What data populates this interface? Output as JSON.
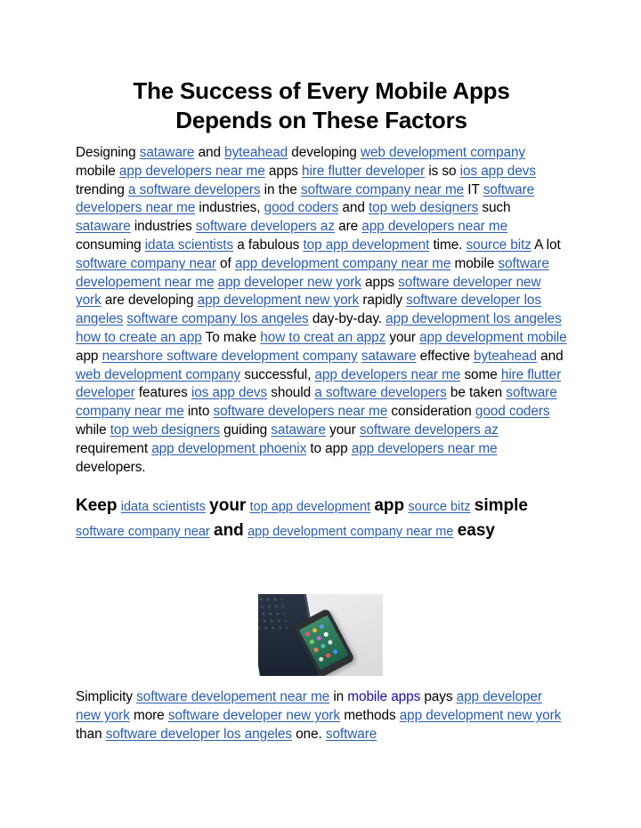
{
  "document": {
    "title_lines": [
      "The Success of Every Mobile Apps",
      "Depends on These Factors"
    ],
    "link_color": "#2a5db0",
    "plain_link_color": "#1a0dab",
    "paragraph_1": [
      {
        "t": "text",
        "v": "Designing "
      },
      {
        "t": "link",
        "v": "sataware"
      },
      {
        "t": "text",
        "v": " and "
      },
      {
        "t": "link",
        "v": "byteahead"
      },
      {
        "t": "text",
        "v": " developing "
      },
      {
        "t": "link",
        "v": "web development company"
      },
      {
        "t": "text",
        "v": " mobile "
      },
      {
        "t": "link",
        "v": "app developers near me"
      },
      {
        "t": "text",
        "v": " apps "
      },
      {
        "t": "link",
        "v": "hire flutter developer"
      },
      {
        "t": "text",
        "v": " is so "
      },
      {
        "t": "link",
        "v": "ios app devs"
      },
      {
        "t": "text",
        "v": " trending "
      },
      {
        "t": "link",
        "v": "a software developers"
      },
      {
        "t": "text",
        "v": " in the "
      },
      {
        "t": "link",
        "v": "software company near me"
      },
      {
        "t": "text",
        "v": " IT "
      },
      {
        "t": "link",
        "v": "software developers near me"
      },
      {
        "t": "text",
        "v": " industries, "
      },
      {
        "t": "link",
        "v": "good coders"
      },
      {
        "t": "text",
        "v": " and "
      },
      {
        "t": "link",
        "v": "top web designers"
      },
      {
        "t": "text",
        "v": " such "
      },
      {
        "t": "link",
        "v": "sataware"
      },
      {
        "t": "text",
        "v": " industries "
      },
      {
        "t": "link",
        "v": "software developers az"
      },
      {
        "t": "text",
        "v": " are "
      },
      {
        "t": "link",
        "v": "app developers near me"
      },
      {
        "t": "text",
        "v": " consuming "
      },
      {
        "t": "link",
        "v": "idata scientists"
      },
      {
        "t": "text",
        "v": " a fabulous "
      },
      {
        "t": "link",
        "v": "top app development"
      },
      {
        "t": "text",
        "v": " time. "
      },
      {
        "t": "link",
        "v": "source bitz"
      },
      {
        "t": "text",
        "v": " A lot "
      },
      {
        "t": "link",
        "v": "software company near"
      },
      {
        "t": "text",
        "v": " of "
      },
      {
        "t": "link",
        "v": "app development company near me"
      },
      {
        "t": "text",
        "v": " mobile "
      },
      {
        "t": "link",
        "v": "software developement near me"
      },
      {
        "t": "text",
        "v": " "
      },
      {
        "t": "link",
        "v": "app developer new york"
      },
      {
        "t": "text",
        "v": " apps "
      },
      {
        "t": "link",
        "v": "software developer new york"
      },
      {
        "t": "text",
        "v": " are developing "
      },
      {
        "t": "link",
        "v": "app development new york"
      },
      {
        "t": "text",
        "v": " rapidly "
      },
      {
        "t": "link",
        "v": "software developer los angeles"
      },
      {
        "t": "text",
        "v": " "
      },
      {
        "t": "link",
        "v": "software company los angeles"
      },
      {
        "t": "text",
        "v": " day-by-day. "
      },
      {
        "t": "link",
        "v": "app development los angeles"
      },
      {
        "t": "text",
        "v": " "
      },
      {
        "t": "link",
        "v": "how to create an app"
      },
      {
        "t": "text",
        "v": " To make "
      },
      {
        "t": "link",
        "v": "how to creat an appz"
      },
      {
        "t": "text",
        "v": " your "
      },
      {
        "t": "link",
        "v": "app development mobile"
      },
      {
        "t": "text",
        "v": " app "
      },
      {
        "t": "link",
        "v": "nearshore software development company"
      },
      {
        "t": "text",
        "v": " "
      },
      {
        "t": "link",
        "v": "sataware"
      },
      {
        "t": "text",
        "v": " effective "
      },
      {
        "t": "link",
        "v": "byteahead"
      },
      {
        "t": "text",
        "v": " and "
      },
      {
        "t": "link",
        "v": "web development company"
      },
      {
        "t": "text",
        "v": " successful, "
      },
      {
        "t": "link",
        "v": "app developers near me"
      },
      {
        "t": "text",
        "v": " some "
      },
      {
        "t": "link",
        "v": "hire flutter developer"
      },
      {
        "t": "text",
        "v": " features "
      },
      {
        "t": "link",
        "v": "ios app devs"
      },
      {
        "t": "text",
        "v": " should "
      },
      {
        "t": "link",
        "v": "a software developers"
      },
      {
        "t": "text",
        "v": " be taken "
      },
      {
        "t": "link",
        "v": "software company near me"
      },
      {
        "t": "text",
        "v": " into "
      },
      {
        "t": "link",
        "v": "software developers near me"
      },
      {
        "t": "text",
        "v": " consideration "
      },
      {
        "t": "link",
        "v": "good coders"
      },
      {
        "t": "text",
        "v": " while "
      },
      {
        "t": "link",
        "v": "top web designers"
      },
      {
        "t": "text",
        "v": " guiding "
      },
      {
        "t": "link",
        "v": "sataware"
      },
      {
        "t": "text",
        "v": " your "
      },
      {
        "t": "link",
        "v": "software developers az"
      },
      {
        "t": "text",
        "v": " requirement "
      },
      {
        "t": "link",
        "v": "app development phoenix"
      },
      {
        "t": "text",
        "v": " to app "
      },
      {
        "t": "link",
        "v": "app developers near me"
      },
      {
        "t": "text",
        "v": " developers."
      }
    ],
    "heading_2": [
      {
        "t": "hword",
        "v": "Keep"
      },
      {
        "t": "text",
        "v": " "
      },
      {
        "t": "link",
        "v": "idata scientists"
      },
      {
        "t": "text",
        "v": " "
      },
      {
        "t": "hword",
        "v": "your"
      },
      {
        "t": "text",
        "v": " "
      },
      {
        "t": "link",
        "v": "top app development"
      },
      {
        "t": "text",
        "v": " "
      },
      {
        "t": "hword",
        "v": "app"
      },
      {
        "t": "text",
        "v": " "
      },
      {
        "t": "link",
        "v": "source bitz"
      },
      {
        "t": "text",
        "v": " "
      },
      {
        "t": "hword",
        "v": "simple"
      },
      {
        "t": "text",
        "v": " "
      },
      {
        "t": "link",
        "v": "software company near"
      },
      {
        "t": "text",
        "v": " "
      },
      {
        "t": "hword",
        "v": "and"
      },
      {
        "t": "text",
        "v": " "
      },
      {
        "t": "link",
        "v": "app development company near me"
      },
      {
        "t": "text",
        "v": " "
      },
      {
        "t": "hword",
        "v": "easy"
      }
    ],
    "image": {
      "alt": "smartphone lying next to laptop keyboard",
      "icon": "photo-phone-laptop"
    },
    "paragraph_3": [
      {
        "t": "text",
        "v": "Simplicity "
      },
      {
        "t": "link",
        "v": "software developement near me"
      },
      {
        "t": "text",
        "v": " in "
      },
      {
        "t": "plain",
        "v": "mobile apps"
      },
      {
        "t": "text",
        "v": " pays "
      },
      {
        "t": "link",
        "v": "app developer new york"
      },
      {
        "t": "text",
        "v": " more "
      },
      {
        "t": "link",
        "v": "software developer new york"
      },
      {
        "t": "text",
        "v": " methods "
      },
      {
        "t": "link",
        "v": "app development new york"
      },
      {
        "t": "text",
        "v": " than "
      },
      {
        "t": "link",
        "v": "software developer los angeles"
      },
      {
        "t": "text",
        "v": " one. "
      },
      {
        "t": "link",
        "v": "software"
      }
    ]
  }
}
